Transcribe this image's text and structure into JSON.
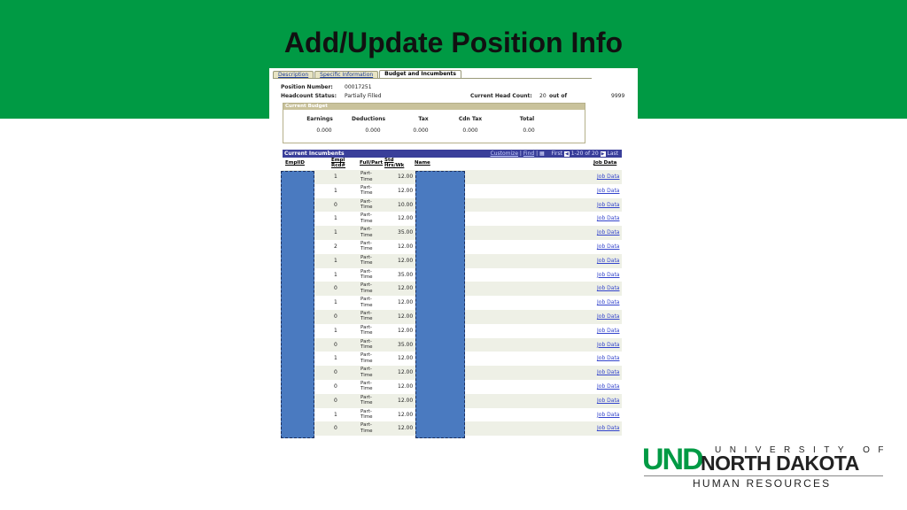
{
  "slide": {
    "title": "Add/Update Position Info",
    "banner_color": "#009a44"
  },
  "tabs": [
    {
      "label": "Description",
      "active": false
    },
    {
      "label": "Specific Information",
      "active": false
    },
    {
      "label": "Budget and Incumbents",
      "active": true
    }
  ],
  "position": {
    "number_label": "Position Number:",
    "number_value": "00017251",
    "status_label": "Headcount Status:",
    "status_value": "Partially Filled",
    "head_count_label": "Current Head Count:",
    "head_count_value": "20",
    "out_of_label": "out of",
    "max_value": "9999"
  },
  "budget": {
    "title": "Current Budget",
    "columns": [
      {
        "label": "Earnings",
        "value": "0.000"
      },
      {
        "label": "Deductions",
        "value": "0.000"
      },
      {
        "label": "Tax",
        "value": "0.000"
      },
      {
        "label": "Cdn Tax",
        "value": "0.000"
      },
      {
        "label": "Total",
        "value": "0.00"
      }
    ]
  },
  "incumbents": {
    "title": "Current Incumbents",
    "customize": "Customize",
    "find": "Find",
    "first": "First",
    "range": "1-20 of 20",
    "last": "Last",
    "headers": {
      "emplid": "EmplID",
      "rcd": "Empl Rcd#",
      "fullpart": "Full/Part",
      "hours": "Std Hrs/Wk",
      "name": "Name",
      "jobdata": "Job Data"
    },
    "rows": [
      {
        "rcd": "1",
        "fp": "Part-Time",
        "hrs": "12.00",
        "link": "Job Data"
      },
      {
        "rcd": "1",
        "fp": "Part-Time",
        "hrs": "12.00",
        "link": "Job Data"
      },
      {
        "rcd": "0",
        "fp": "Part-Time",
        "hrs": "10.00",
        "link": "Job Data"
      },
      {
        "rcd": "1",
        "fp": "Part-Time",
        "hrs": "12.00",
        "link": "Job Data"
      },
      {
        "rcd": "1",
        "fp": "Part-Time",
        "hrs": "35.00",
        "link": "Job Data"
      },
      {
        "rcd": "2",
        "fp": "Part-Time",
        "hrs": "12.00",
        "link": "Job Data"
      },
      {
        "rcd": "1",
        "fp": "Part-Time",
        "hrs": "12.00",
        "link": "Job Data"
      },
      {
        "rcd": "1",
        "fp": "Part-Time",
        "hrs": "35.00",
        "link": "Job Data"
      },
      {
        "rcd": "0",
        "fp": "Part-Time",
        "hrs": "12.00",
        "link": "Job Data"
      },
      {
        "rcd": "1",
        "fp": "Part-Time",
        "hrs": "12.00",
        "link": "Job Data"
      },
      {
        "rcd": "0",
        "fp": "Part-Time",
        "hrs": "12.00",
        "link": "Job Data"
      },
      {
        "rcd": "1",
        "fp": "Part-Time",
        "hrs": "12.00",
        "link": "Job Data"
      },
      {
        "rcd": "0",
        "fp": "Part-Time",
        "hrs": "35.00",
        "link": "Job Data"
      },
      {
        "rcd": "1",
        "fp": "Part-Time",
        "hrs": "12.00",
        "link": "Job Data"
      },
      {
        "rcd": "0",
        "fp": "Part-Time",
        "hrs": "12.00",
        "link": "Job Data"
      },
      {
        "rcd": "0",
        "fp": "Part-Time",
        "hrs": "12.00",
        "link": "Job Data"
      },
      {
        "rcd": "0",
        "fp": "Part-Time",
        "hrs": "12.00",
        "link": "Job Data"
      },
      {
        "rcd": "1",
        "fp": "Part-Time",
        "hrs": "12.00",
        "link": "Job Data"
      },
      {
        "rcd": "0",
        "fp": "Part-Time",
        "hrs": "12.00",
        "link": "Job Data"
      }
    ]
  },
  "logo": {
    "und": "UND",
    "university": "UNIVERSITY OF",
    "north_dakota": "NORTH DAKOTA",
    "hr": "HUMAN RESOURCES",
    "green": "#009a44"
  }
}
